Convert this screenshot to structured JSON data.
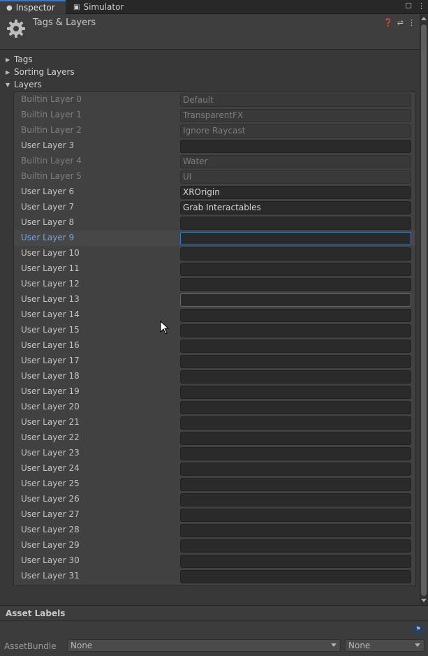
{
  "tabs": [
    {
      "label": "Inspector",
      "icon": "info-icon",
      "active": true
    },
    {
      "label": "Simulator",
      "icon": "device-icon",
      "active": false
    }
  ],
  "header": {
    "title": "Tags & Layers"
  },
  "foldouts": {
    "tags": "Tags",
    "sorting_layers": "Sorting Layers",
    "layers": "Layers"
  },
  "layers": [
    {
      "label": "Builtin Layer 0",
      "value": "Default",
      "builtin": true
    },
    {
      "label": "Builtin Layer 1",
      "value": "TransparentFX",
      "builtin": true
    },
    {
      "label": "Builtin Layer 2",
      "value": "Ignore Raycast",
      "builtin": true
    },
    {
      "label": "User Layer 3",
      "value": "",
      "builtin": false
    },
    {
      "label": "Builtin Layer 4",
      "value": "Water",
      "builtin": true
    },
    {
      "label": "Builtin Layer 5",
      "value": "UI",
      "builtin": true
    },
    {
      "label": "User Layer 6",
      "value": "XROrigin",
      "builtin": false
    },
    {
      "label": "User Layer 7",
      "value": "Grab Interactables",
      "builtin": false
    },
    {
      "label": "User Layer 8",
      "value": "",
      "builtin": false
    },
    {
      "label": "User Layer 9",
      "value": "",
      "builtin": false,
      "selected": true
    },
    {
      "label": "User Layer 10",
      "value": "",
      "builtin": false
    },
    {
      "label": "User Layer 11",
      "value": "",
      "builtin": false
    },
    {
      "label": "User Layer 12",
      "value": "",
      "builtin": false
    },
    {
      "label": "User Layer 13",
      "value": "",
      "builtin": false,
      "hover": true
    },
    {
      "label": "User Layer 14",
      "value": "",
      "builtin": false
    },
    {
      "label": "User Layer 15",
      "value": "",
      "builtin": false
    },
    {
      "label": "User Layer 16",
      "value": "",
      "builtin": false
    },
    {
      "label": "User Layer 17",
      "value": "",
      "builtin": false
    },
    {
      "label": "User Layer 18",
      "value": "",
      "builtin": false
    },
    {
      "label": "User Layer 19",
      "value": "",
      "builtin": false
    },
    {
      "label": "User Layer 20",
      "value": "",
      "builtin": false
    },
    {
      "label": "User Layer 21",
      "value": "",
      "builtin": false
    },
    {
      "label": "User Layer 22",
      "value": "",
      "builtin": false
    },
    {
      "label": "User Layer 23",
      "value": "",
      "builtin": false
    },
    {
      "label": "User Layer 24",
      "value": "",
      "builtin": false
    },
    {
      "label": "User Layer 25",
      "value": "",
      "builtin": false
    },
    {
      "label": "User Layer 26",
      "value": "",
      "builtin": false
    },
    {
      "label": "User Layer 27",
      "value": "",
      "builtin": false
    },
    {
      "label": "User Layer 28",
      "value": "",
      "builtin": false
    },
    {
      "label": "User Layer 29",
      "value": "",
      "builtin": false
    },
    {
      "label": "User Layer 30",
      "value": "",
      "builtin": false
    },
    {
      "label": "User Layer 31",
      "value": "",
      "builtin": false
    }
  ],
  "asset_labels": {
    "title": "Asset Labels",
    "assetbundle_label": "AssetBundle",
    "bundle_value": "None",
    "variant_value": "None"
  },
  "colors": {
    "accent": "#3a79bb",
    "selected_label": "#6fa3f0",
    "background": "#383838"
  }
}
